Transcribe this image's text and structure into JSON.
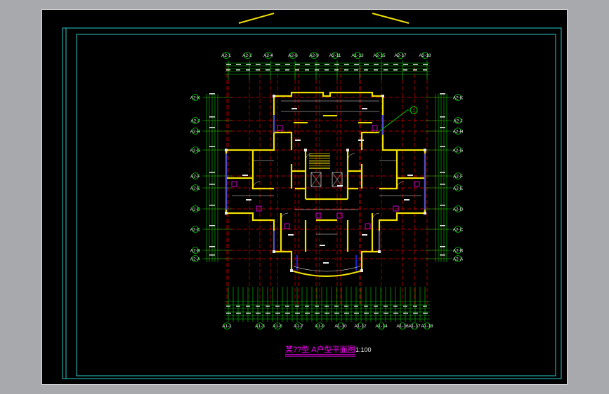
{
  "drawing": {
    "title_prefix": "某??型 A户型平面图",
    "title_suffix": "1:100",
    "top_axes": [
      "A2-1",
      "A2-2",
      "A2-4",
      "A2-6",
      "A2-9",
      "A2-11",
      "A1-13",
      "A2-15",
      "A2-17",
      "A2-18"
    ],
    "bottom_axes": [
      "A1-1",
      "A1-3",
      "A1-5",
      "A1-7",
      "A1-9",
      "A1-10",
      "A1-12",
      "A1-14",
      "A1-16",
      "A1-17",
      "A1-18"
    ],
    "left_axes": [
      "A2-K",
      "A2-J",
      "A2-H",
      "A2-G",
      "A2-F",
      "A2-E",
      "A2-D",
      "A2-C",
      "A2-B",
      "A2-A"
    ],
    "right_axes": [
      "A2-K",
      "A2-J",
      "A2-H",
      "A2-G",
      "A2-F",
      "A2-E",
      "A2-D",
      "A2-C",
      "A2-B",
      "A2-A"
    ],
    "legend_marker": "1",
    "colors": {
      "background": "#000000",
      "frame": "#28c8c8",
      "axis_grid": "#d80000",
      "walls": "#f0e000",
      "dimensions": "#00d000",
      "text": "#e8e8e8",
      "fixtures": "#ff00ff",
      "doors": "#2828ff",
      "title_underline": "#ff00ff"
    }
  }
}
